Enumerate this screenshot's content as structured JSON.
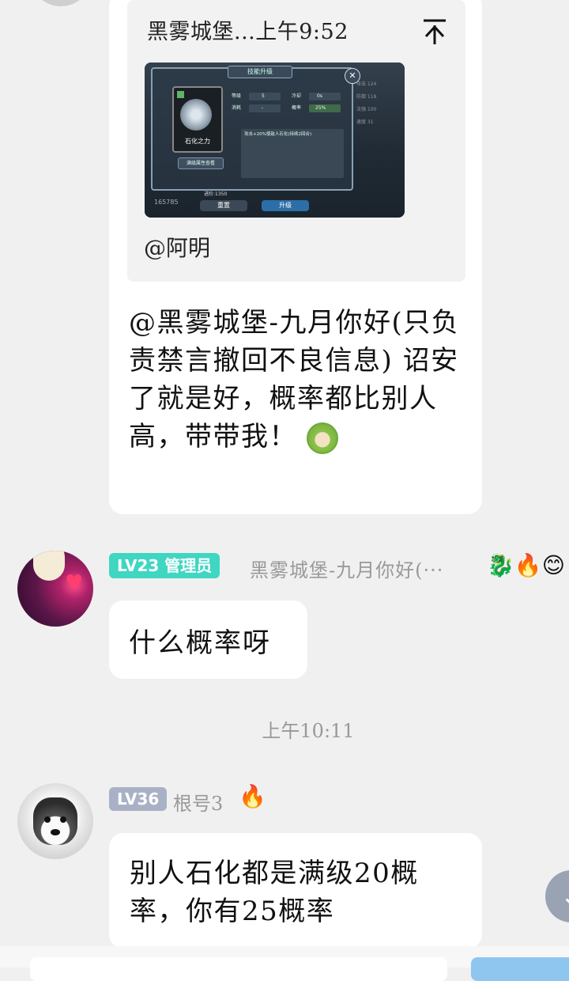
{
  "quote": {
    "title": "黑雾城堡...上午9:52",
    "pin_icon": "pin-top-icon",
    "mention": "@阿明",
    "game": {
      "header": "技能升级",
      "card_label": "石化之力",
      "attr_button": "满级属性查看",
      "stats": [
        {
          "label": "等级",
          "value": "5"
        },
        {
          "label": "冷却",
          "value": "0s"
        },
        {
          "label": "消耗",
          "value": "-"
        },
        {
          "label": "概率",
          "value": "25%"
        }
      ],
      "desc": "攻击+20%使敌人石化(持续2回合)",
      "cost": "进阶:1350",
      "reset": "重置",
      "upgrade": "升级",
      "power": "165785",
      "right_stats": "攻击 124\n防御 118\n法强 100\n速度 31"
    }
  },
  "messages": [
    {
      "text": "@黑雾城堡-九月你好(只负责禁言撤回不良信息) 诏安了就是好，概率都比别人高，带带我！",
      "emoji": "dog-face-emoji"
    },
    {
      "level_badge": "LV23 管理员",
      "level_color": "#3fd6c2",
      "name": "黑雾城堡-九月你好(···",
      "tags": "🐉🔥😊",
      "text": "什么概率呀"
    },
    {
      "level_badge": "LV36",
      "level_color": "#a9b1c6",
      "name": "根号3",
      "tags": "🔥",
      "text": "别人石化都是满级20概率，你有25概率"
    }
  ],
  "timestamp": "上午10:11",
  "scroll_button": "chevron-down-icon"
}
